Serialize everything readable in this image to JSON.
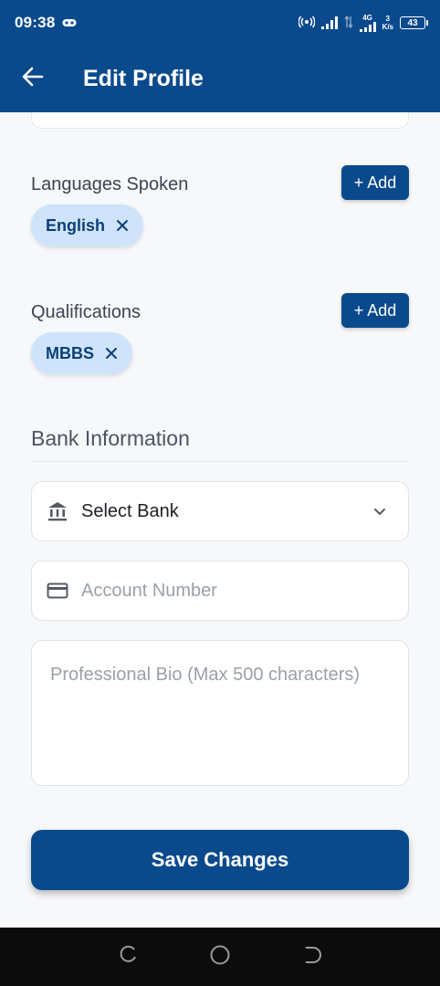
{
  "status_bar": {
    "time": "09:38",
    "network_type": "4G",
    "data_speed_value": "3",
    "data_speed_unit": "K/s",
    "battery": "43"
  },
  "app_bar": {
    "title": "Edit Profile",
    "back_icon": "arrow-left-icon"
  },
  "languages": {
    "label": "Languages Spoken",
    "add_label": "+ Add",
    "chips": [
      "English"
    ]
  },
  "qualifications": {
    "label": "Qualifications",
    "add_label": "+ Add",
    "chips": [
      "MBBS"
    ]
  },
  "bank": {
    "title": "Bank Information",
    "select_bank_value": "Select Bank",
    "account_placeholder": "Account Number"
  },
  "bio": {
    "placeholder": "Professional Bio (Max 500 characters)"
  },
  "save_label": "Save Changes",
  "colors": {
    "primary": "#0a4a8c",
    "chip_bg": "#cfe4fb",
    "page_bg": "#f7f8fa"
  }
}
